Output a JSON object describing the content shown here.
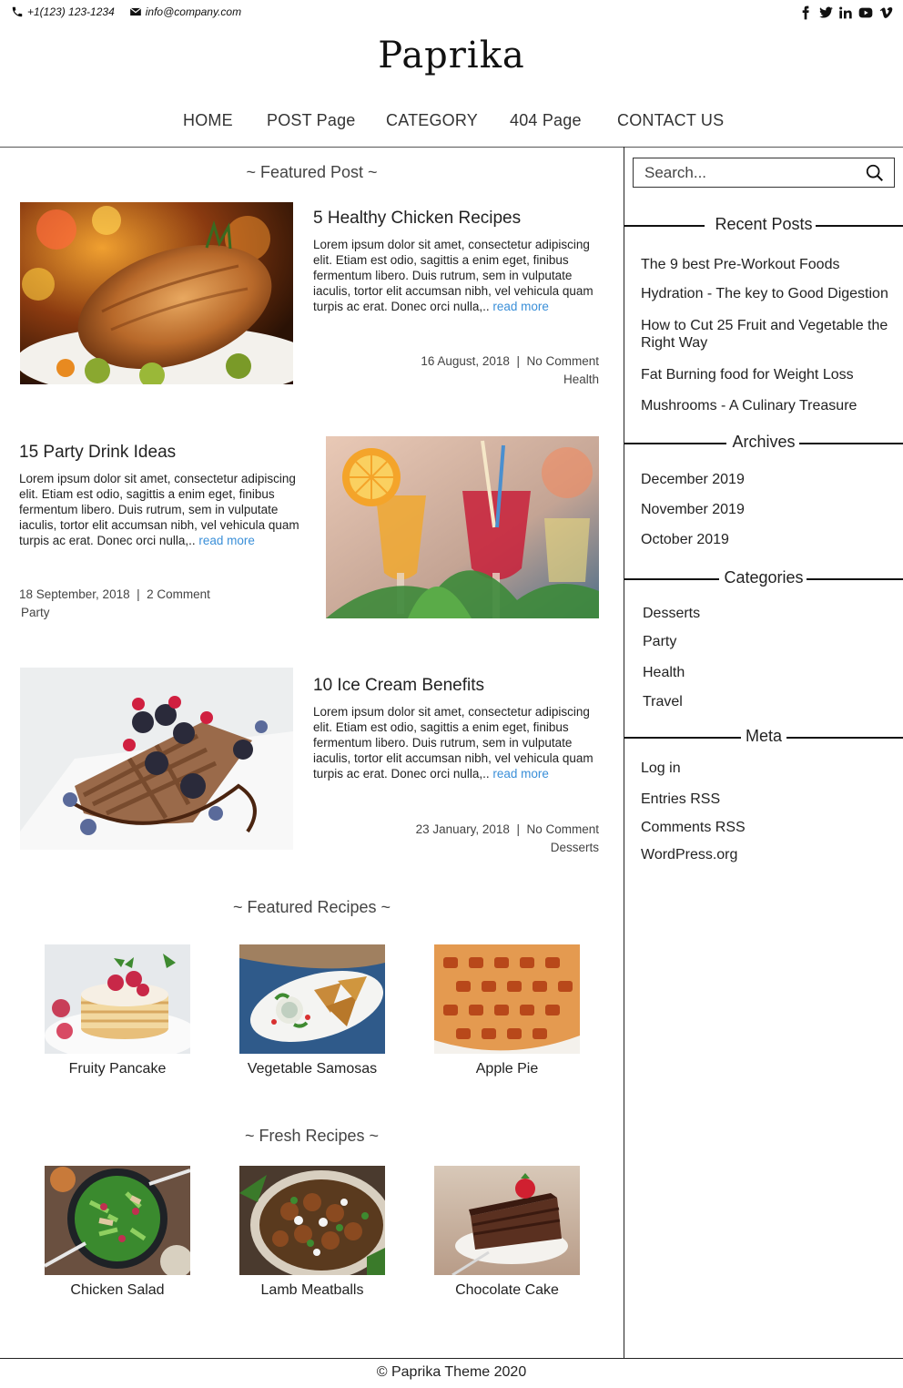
{
  "contact": {
    "phone": "+1(123) 123-1234",
    "email": "info@company.com"
  },
  "social": [
    "facebook-icon",
    "twitter-icon",
    "linkedin-icon",
    "youtube-icon",
    "vimeo-icon"
  ],
  "site": {
    "title": "Paprika"
  },
  "nav": [
    "HOME",
    "POST Page",
    "CATEGORY",
    "404 Page",
    "CONTACT US"
  ],
  "main": {
    "featured_post_title": "~ Featured Post ~",
    "posts": [
      {
        "title": "5 Healthy Chicken Recipes",
        "excerpt": "Lorem ipsum dolor sit amet, consectetur adipiscing elit. Etiam est odio, sagittis a enim eget, finibus fermentum libero. Duis rutrum, sem in vulputate iaculis, tortor elit accumsan nibh, vel vehicula quam turpis ac erat. Donec orci nulla,..",
        "read_more": "read more",
        "date": "16 August, 2018",
        "sep": "|",
        "comments": "No Comment",
        "category": "Health"
      },
      {
        "title": "15 Party Drink Ideas",
        "excerpt": "Lorem ipsum dolor sit amet, consectetur adipiscing elit. Etiam est odio, sagittis a enim eget, finibus fermentum libero. Duis rutrum, sem in vulputate iaculis, tortor elit accumsan nibh, vel vehicula quam turpis ac erat. Donec orci nulla,..",
        "read_more": "read more",
        "date": "18 September, 2018",
        "sep": "|",
        "comments": "2 Comment",
        "category": "Party"
      },
      {
        "title": "10 Ice Cream Benefits",
        "excerpt": "Lorem ipsum dolor sit amet, consectetur adipiscing elit. Etiam est odio, sagittis a enim eget, finibus fermentum libero. Duis rutrum, sem in vulputate iaculis, tortor elit accumsan nibh, vel vehicula quam turpis ac erat. Donec orci nulla,..",
        "read_more": "read more",
        "date": "23 January, 2018",
        "sep": "|",
        "comments": "No Comment",
        "category": "Desserts"
      }
    ],
    "featured_recipes_title": "~ Featured Recipes ~",
    "featured_recipes": [
      "Fruity Pancake",
      "Vegetable Samosas",
      "Apple Pie"
    ],
    "fresh_recipes_title": "~ Fresh Recipes ~",
    "fresh_recipes": [
      "Chicken Salad",
      "Lamb Meatballs",
      "Chocolate Cake"
    ]
  },
  "sidebar": {
    "search_placeholder": "Search...",
    "recent_posts_title": "Recent Posts",
    "recent_posts": [
      "The 9 best Pre-Workout Foods",
      "Hydration - The key to Good Digestion",
      "How to Cut 25 Fruit and Vegetable the Right Way",
      "Fat Burning food for Weight Loss",
      "Mushrooms - A Culinary Treasure"
    ],
    "archives_title": "Archives",
    "archives": [
      "December 2019",
      "November 2019",
      "October 2019"
    ],
    "categories_title": "Categories",
    "categories": [
      "Desserts",
      "Party",
      "Health",
      "Travel"
    ],
    "meta_title": "Meta",
    "meta": [
      "Log in",
      "Entries RSS",
      "Comments RSS",
      "WordPress.org"
    ]
  },
  "footer": {
    "text": "© Paprika Theme 2020"
  },
  "colors": {
    "link": "#3a8fd8",
    "text": "#222222",
    "rule": "#111111"
  }
}
